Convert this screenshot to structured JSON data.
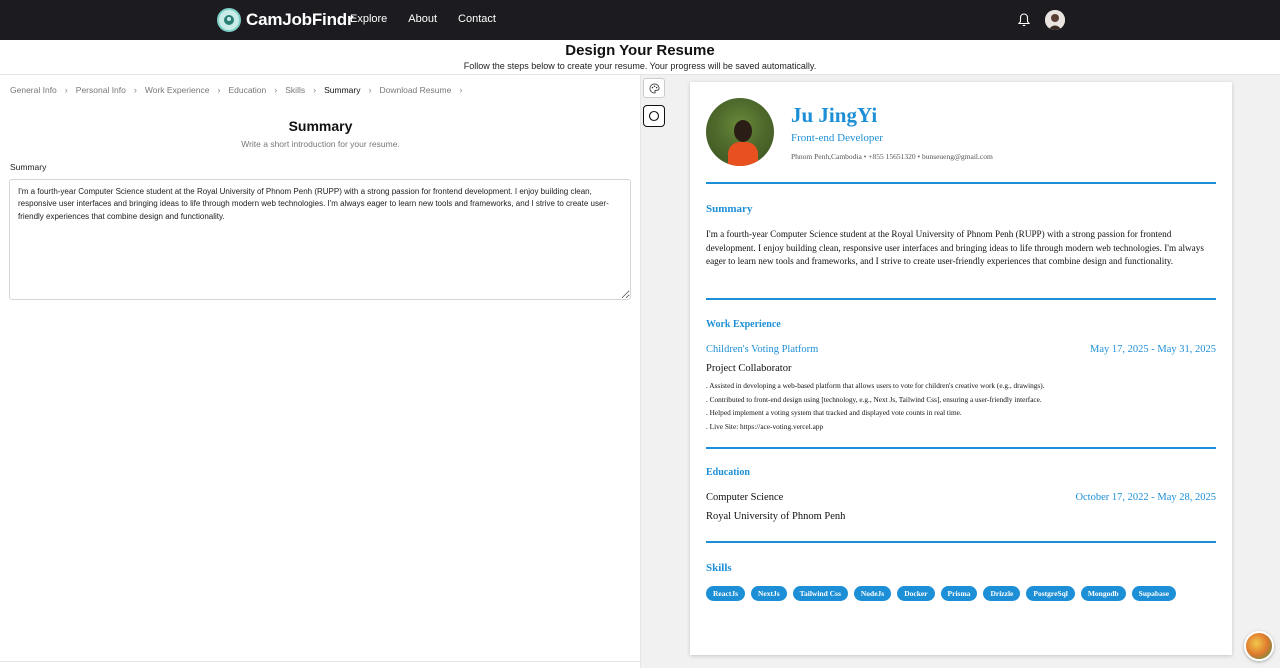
{
  "nav": {
    "brand": "CamJobFindr",
    "links": [
      "Explore",
      "About",
      "Contact"
    ]
  },
  "header": {
    "title": "Design Your Resume",
    "subtitle": "Follow the steps below to create your resume. Your progress will be saved automatically."
  },
  "breadcrumb": [
    "General Info",
    "Personal Info",
    "Work Experience",
    "Education",
    "Skills",
    "Summary",
    "Download Resume"
  ],
  "breadcrumb_active": "Summary",
  "form": {
    "title": "Summary",
    "subtitle": "Write a short introduction for your resume.",
    "field_label": "Summary",
    "summary_value": "I'm a fourth-year Computer Science student at the Royal University of Phnom Penh (RUPP) with a strong passion for frontend development. I enjoy building clean, responsive user interfaces and bringing ideas to life through modern web technologies. I'm always eager to learn new tools and frameworks, and I strive to create user-friendly experiences that combine design and functionality."
  },
  "resume": {
    "name": "Ju JingYi",
    "role": "Front-end Developer",
    "contact": "Phnom Penh,Cambodia • +855 15651320 • bunseueng@gmail.com",
    "summary_heading": "Summary",
    "summary": "I'm a fourth-year Computer Science student at the Royal University of Phnom Penh (RUPP) with a strong passion for frontend development. I enjoy building clean, responsive user interfaces and bringing ideas to life through modern web technologies. I'm always eager to learn new tools and frameworks, and I strive to create user-friendly experiences that combine design and functionality.",
    "work_heading": "Work Experience",
    "job": {
      "title": "Children's Voting Platform",
      "dates": "May 17, 2025 - May 31, 2025",
      "role": "Project Collaborator",
      "bullets": [
        ". Assisted in developing a web-based platform that allows users to vote for children's creative work (e.g., drawings).",
        ". Contributed to front-end design using [technology, e.g., Next Js, Tailwind Css], ensuring a user-friendly interface.",
        ". Helped implement a voting system that tracked and displayed vote counts in real time.",
        ". Live Site: https://ace-voting.vercel.app"
      ]
    },
    "education_heading": "Education",
    "education": {
      "degree": "Computer Science",
      "dates": "October 17, 2022 - May 28, 2025",
      "school": "Royal University of Phnom Penh"
    },
    "skills_heading": "Skills",
    "skills": [
      "ReactJs",
      "NextJs",
      "Tailwind Css",
      "NodeJs",
      "Docker",
      "Prisma",
      "Drizzle",
      "PostgreSql",
      "Mongodb",
      "Supabase"
    ]
  },
  "colors": {
    "accent": "#1d8fd6",
    "navbar": "#1c1c20"
  }
}
